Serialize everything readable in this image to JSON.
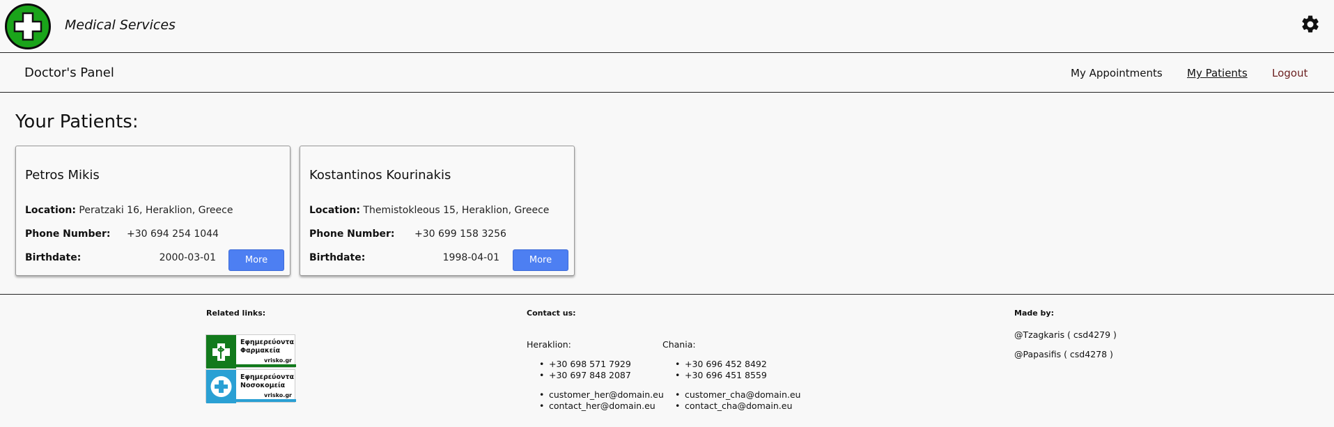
{
  "header": {
    "brand": "Medical Services",
    "settings_icon": "gear-icon"
  },
  "nav": {
    "panel_title": "Doctor's Panel",
    "links": [
      "My Appointments",
      "My Patients",
      "Logout"
    ]
  },
  "main": {
    "heading": "Your Patients:",
    "labels": {
      "location": "Location:",
      "phone": "Phone Number:",
      "birthdate": "Birthdate:",
      "more": "More"
    },
    "patients": [
      {
        "name": "Petros Mikis",
        "location": "Peratzaki 16, Heraklion, Greece",
        "phone": "+30 694 254 1044",
        "birthdate": "2000-03-01"
      },
      {
        "name": "Kostantinos Kourinakis",
        "location": "Themistokleous 15, Heraklion, Greece",
        "phone": "+30 699 158 3256",
        "birthdate": "1998-04-01"
      }
    ]
  },
  "footer": {
    "related_title": "Related links:",
    "badges": [
      {
        "line1": "Εφημερεύοντα",
        "line2": "Φαρμακεία",
        "site": "vrisko.gr",
        "color": "#127a1c"
      },
      {
        "line1": "Εφημερεύοντα",
        "line2": "Νοσοκομεία",
        "site": "vrisko.gr",
        "color": "#2aa0d4"
      }
    ],
    "contact_title": "Contact us:",
    "heraklion": {
      "city": "Heraklion:",
      "phones": [
        "+30 698 571 7929",
        "+30 697 848 2087"
      ],
      "emails": [
        "customer_her@domain.eu",
        "contact_her@domain.eu"
      ]
    },
    "chania": {
      "city": "Chania:",
      "phones": [
        "+30 696 452 8492",
        "+30 696 451 8559"
      ],
      "emails": [
        "customer_cha@domain.eu",
        "contact_cha@domain.eu"
      ]
    },
    "made_title": "Made by:",
    "authors": [
      "@Tzagkaris ( csd4279 )",
      "@Papasifis ( csd4278 )"
    ]
  },
  "colors": {
    "logo_green": "#1aa41a",
    "button_blue": "#4d7ff2",
    "logout_red": "#6b1f1f"
  }
}
